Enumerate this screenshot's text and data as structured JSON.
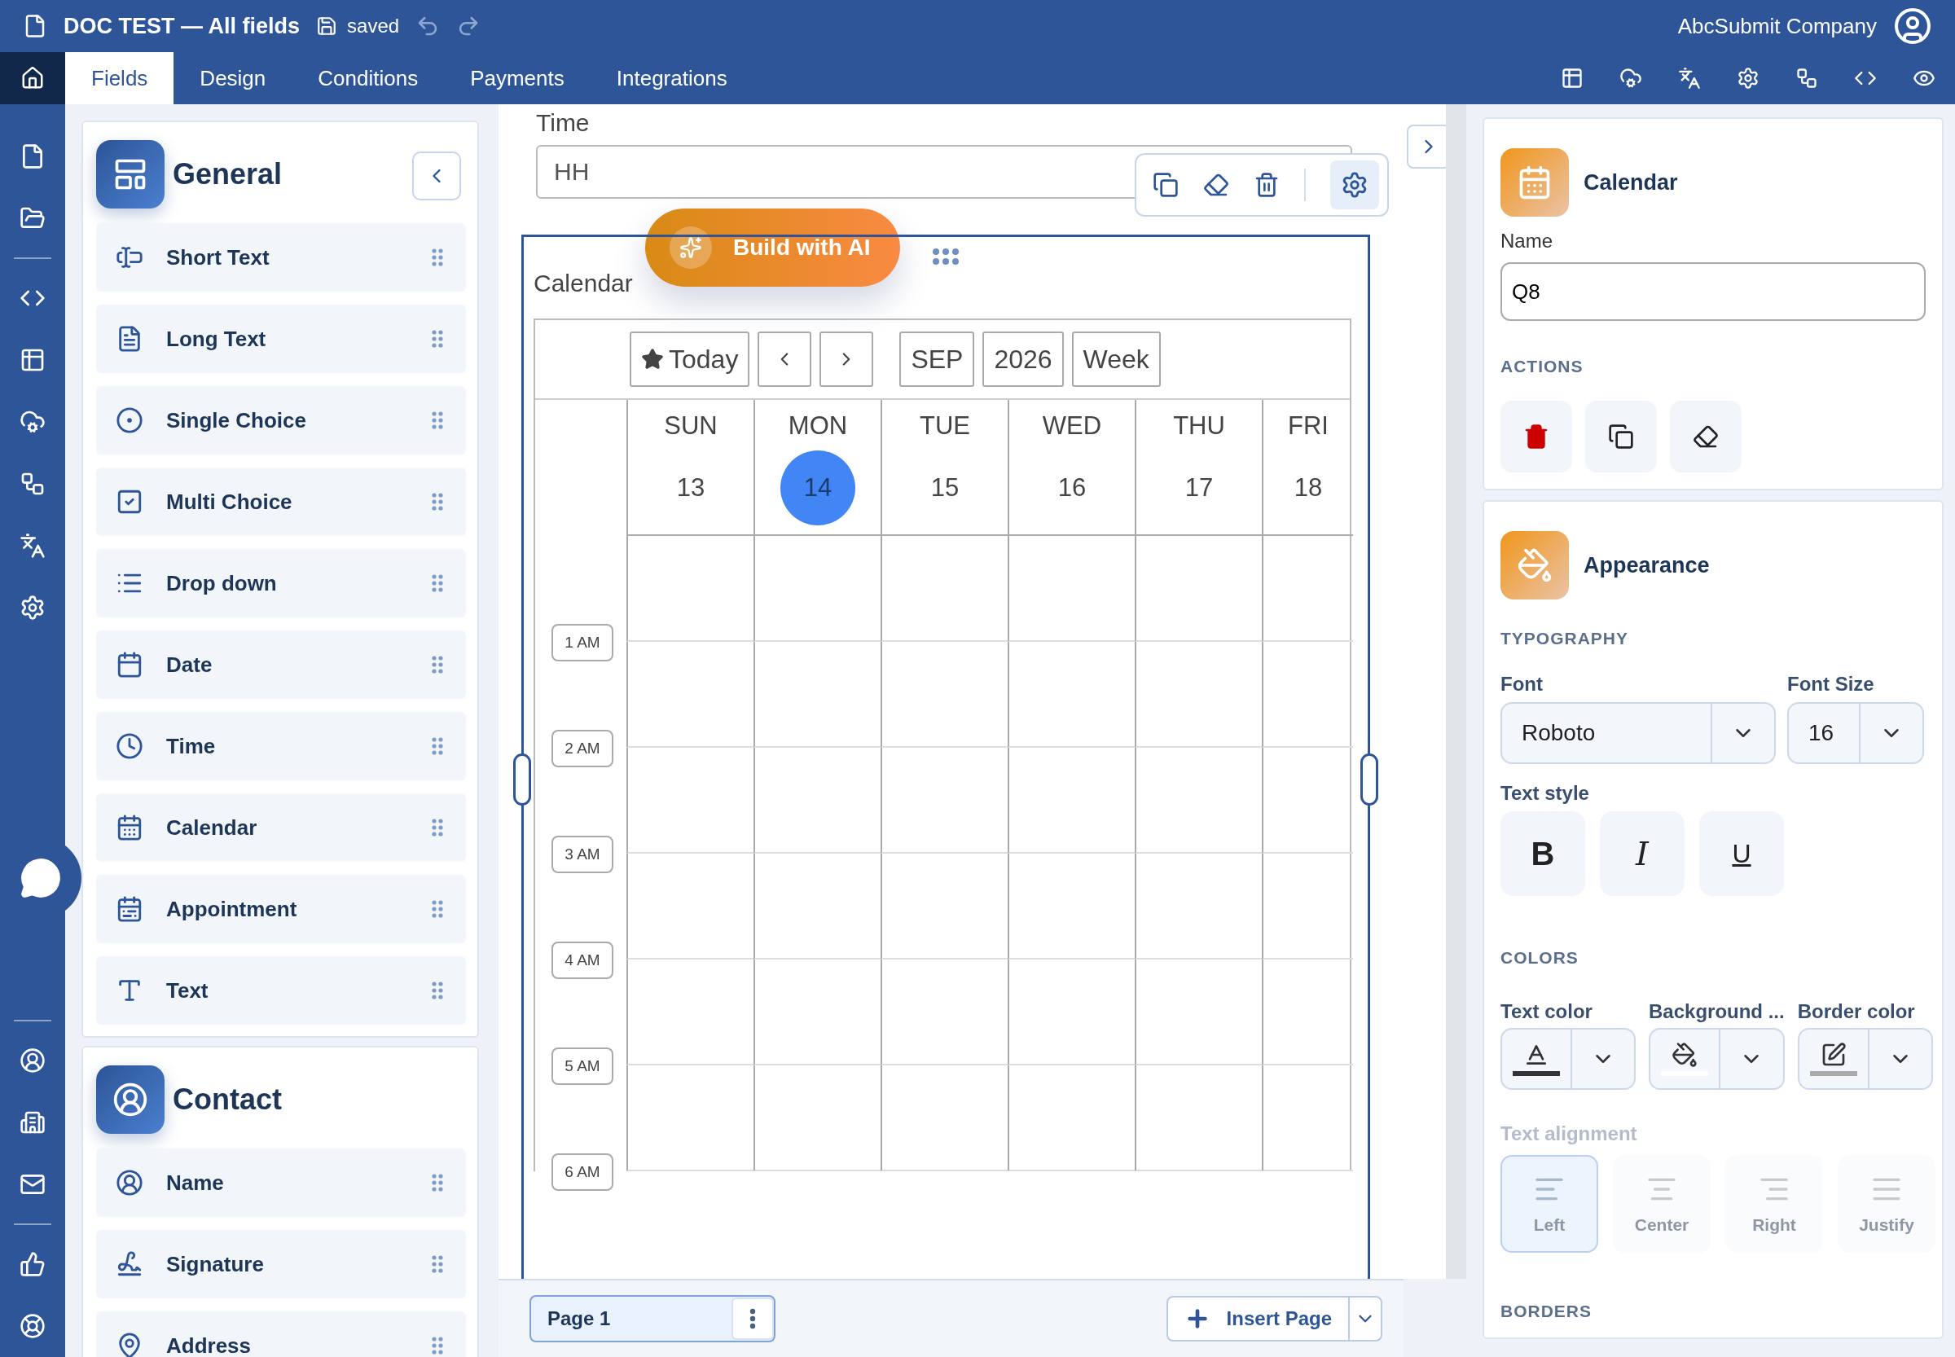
{
  "header": {
    "title": "DOC TEST — All fields",
    "save_status": "saved",
    "account": "AbcSubmit Company"
  },
  "tabs": [
    {
      "label": "Fields",
      "selected": true
    },
    {
      "label": "Design",
      "selected": false
    },
    {
      "label": "Conditions",
      "selected": false
    },
    {
      "label": "Payments",
      "selected": false
    },
    {
      "label": "Integrations",
      "selected": false
    }
  ],
  "field_groups": [
    {
      "title": "General",
      "items": [
        {
          "label": "Short Text"
        },
        {
          "label": "Long Text"
        },
        {
          "label": "Single Choice"
        },
        {
          "label": "Multi Choice"
        },
        {
          "label": "Drop down"
        },
        {
          "label": "Date"
        },
        {
          "label": "Time"
        },
        {
          "label": "Calendar"
        },
        {
          "label": "Appointment"
        },
        {
          "label": "Text"
        }
      ]
    },
    {
      "title": "Contact",
      "items": [
        {
          "label": "Name"
        },
        {
          "label": "Signature"
        },
        {
          "label": "Address"
        }
      ]
    }
  ],
  "form": {
    "time_label": "Time",
    "time_placeholder": "HH",
    "ai_button": "Build with AI",
    "calendar": {
      "label": "Calendar",
      "today": "Today",
      "month": "SEP",
      "year": "2026",
      "view": "Week",
      "days": [
        {
          "name": "SUN",
          "date": "13",
          "selected": false
        },
        {
          "name": "MON",
          "date": "14",
          "selected": true
        },
        {
          "name": "TUE",
          "date": "15",
          "selected": false
        },
        {
          "name": "WED",
          "date": "16",
          "selected": false
        },
        {
          "name": "THU",
          "date": "17",
          "selected": false
        },
        {
          "name": "FRI",
          "date": "18",
          "selected": false
        }
      ],
      "hours": [
        "1 AM",
        "2 AM",
        "3 AM",
        "4 AM",
        "5 AM",
        "6 AM"
      ]
    }
  },
  "pages": [
    {
      "label": "Page 1",
      "selected": true
    }
  ],
  "insert_page": "Insert Page",
  "properties": {
    "title": "Calendar",
    "name_label": "Name",
    "name_value": "Q8",
    "actions_heading": "ACTIONS"
  },
  "appearance": {
    "title": "Appearance",
    "typography_heading": "TYPOGRAPHY",
    "font_label": "Font",
    "font_value": "Roboto",
    "font_size_label": "Font Size",
    "font_size_value": "16",
    "text_style_label": "Text style",
    "text_styles": [
      {
        "label": "B"
      },
      {
        "label": "I"
      },
      {
        "label": "U"
      }
    ],
    "colors_heading": "COLORS",
    "color_pickers": [
      {
        "label": "Text color",
        "color": "#333333"
      },
      {
        "label": "Background ...",
        "color": "#ffffff"
      },
      {
        "label": "Border color",
        "color": "#aaaaaa"
      }
    ],
    "alignment_label": "Text alignment",
    "alignment_disabled": true,
    "alignments": [
      {
        "label": "Left",
        "selected": true
      },
      {
        "label": "Center",
        "selected": false
      },
      {
        "label": "Right",
        "selected": false
      },
      {
        "label": "Justify",
        "selected": false
      }
    ],
    "borders_heading": "BORDERS"
  }
}
